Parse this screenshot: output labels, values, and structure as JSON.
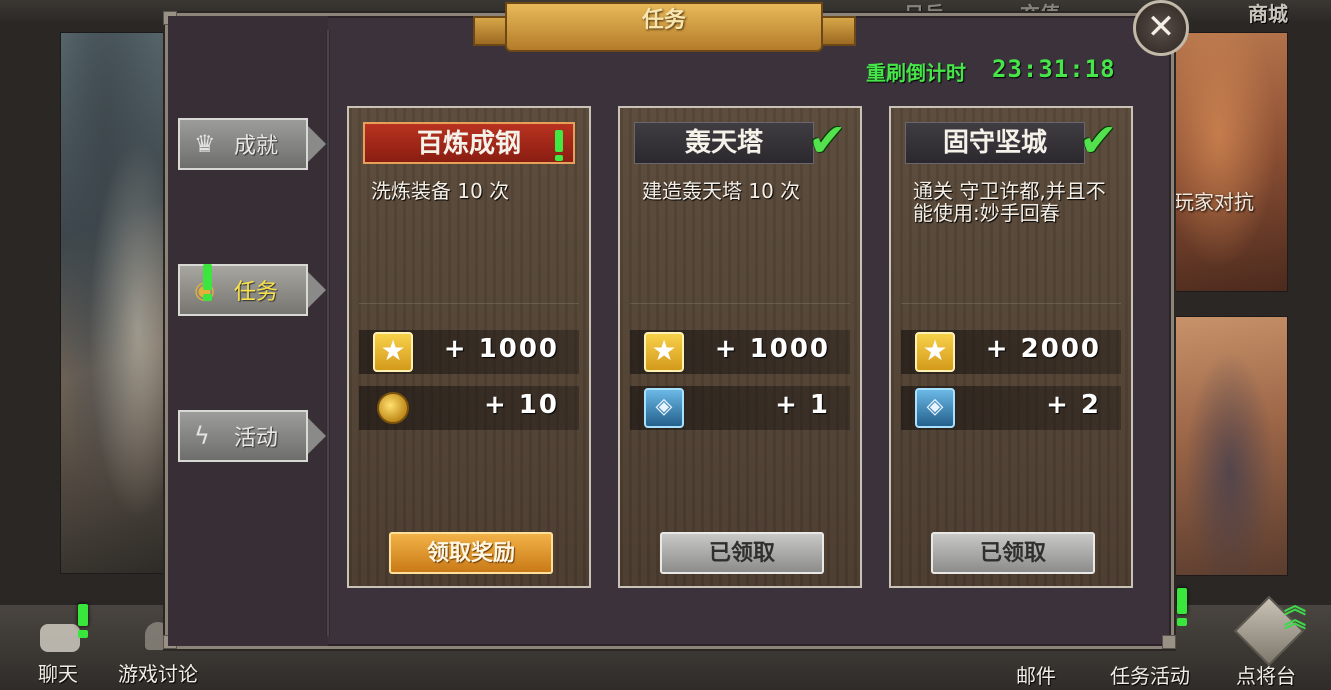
{
  "background": {
    "top_tabs": [
      "日兵",
      "充值",
      "商城"
    ],
    "right_panel_label": "玩家对抗"
  },
  "dialog": {
    "title": "任务",
    "close_glyph": "✕",
    "countdown_label": "重刷倒计时",
    "countdown_time": "23:31:18"
  },
  "sidebar": {
    "tabs": [
      {
        "label": "成就",
        "icon": "crown-icon",
        "active": false
      },
      {
        "label": "任务",
        "icon": "eye-icon",
        "active": true
      },
      {
        "label": "活动",
        "icon": "lightning-icon",
        "active": false
      }
    ]
  },
  "quests": [
    {
      "title": "百炼成钢",
      "status": "alert",
      "description": "洗炼装备 10 次",
      "rewards": [
        {
          "icon": "star-icon",
          "value": "+ 1000"
        },
        {
          "icon": "coins-icon",
          "value": "+ 10"
        }
      ],
      "button": "领取奖励",
      "button_style": "gold"
    },
    {
      "title": "轰天塔",
      "status": "completed",
      "description": "建造轰天塔 10 次",
      "rewards": [
        {
          "icon": "star-icon",
          "value": "+ 1000"
        },
        {
          "icon": "card-icon",
          "value": "+ 1"
        }
      ],
      "button": "已领取",
      "button_style": "grey"
    },
    {
      "title": "固守坚城",
      "status": "completed",
      "description": "通关 守卫许都,并且不能使用:妙手回春",
      "rewards": [
        {
          "icon": "star-icon",
          "value": "+ 2000"
        },
        {
          "icon": "card-icon",
          "value": "+ 2"
        }
      ],
      "button": "已领取",
      "button_style": "grey"
    }
  ],
  "dock": {
    "items": [
      "聊天",
      "游戏讨论",
      "邮件",
      "任务活动",
      "点将台"
    ]
  },
  "colors": {
    "alert_green": "#39e63c",
    "gold_button": "#e6a03a",
    "active_tab_text": "#f6e24a"
  }
}
